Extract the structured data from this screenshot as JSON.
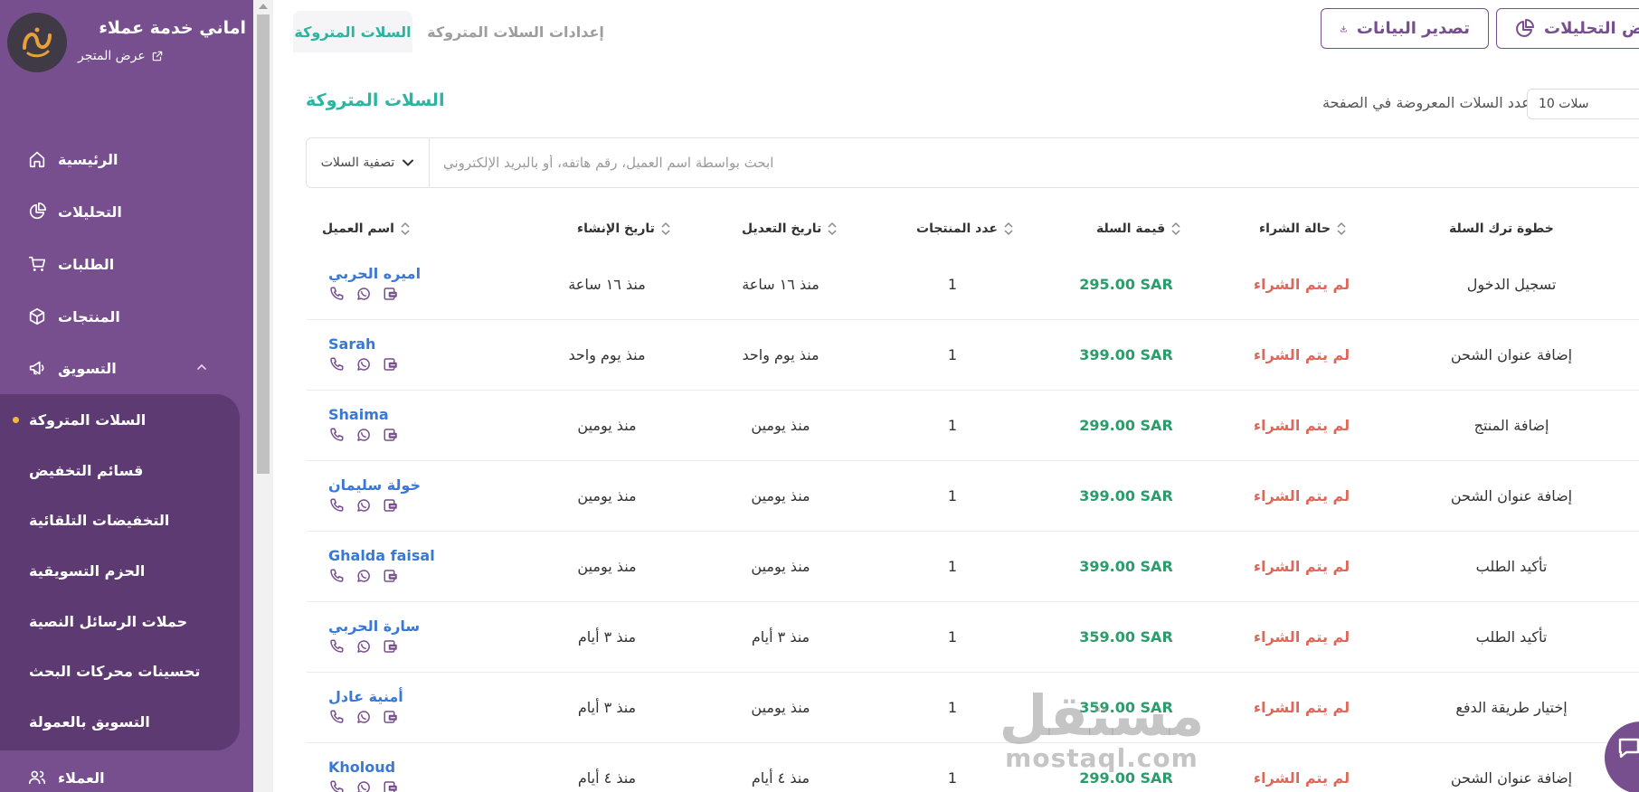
{
  "brand": {
    "name": "اماني خدمة عملاء",
    "store_link": "عرض المتجر"
  },
  "nav": {
    "home": "الرئيسية",
    "analytics": "التحليلات",
    "orders": "الطلبات",
    "products": "المنتجات",
    "marketing": "التسويق",
    "customers": "العملاء"
  },
  "marketing_sub": {
    "abandoned_carts": "السلات المتروكة",
    "coupons": "قسائم التخفيض",
    "auto_discounts": "التخفيضات التلقائية",
    "bundles": "الحزم التسويقية",
    "sms_campaigns": "حملات الرسائل النصية",
    "seo": "تحسينات محركات البحث",
    "affiliate": "التسويق بالعمولة"
  },
  "tabs": {
    "abandoned": "السلات المتروكة",
    "settings": "إعدادات السلات المتروكة"
  },
  "buttons": {
    "export": "تصدير البيانات",
    "analytics": "عرض التحليلات"
  },
  "section_title": "السلات المتروكة",
  "per_page": {
    "label": "عدد السلات المعروضة في الصفحة",
    "value": "10 سلات"
  },
  "search": {
    "placeholder": "ابحث بواسطة اسم العميل، رقم هاتفه، أو بالبريد الإلكتروني",
    "filter": "تصفية السلات"
  },
  "columns": {
    "customer": "اسم العميل",
    "created": "تاريخ الإنشاء",
    "modified": "تاريخ التعديل",
    "products": "عدد المنتجات",
    "value": "قيمة السلة",
    "status": "حالة الشراء",
    "step": "خطوة ترك السلة"
  },
  "rows": [
    {
      "customer": "اميره الحربي",
      "created": "منذ ١٦ ساعة",
      "modified": "منذ ١٦ ساعة",
      "products": "1",
      "value": "295.00 SAR",
      "status": "لم يتم الشراء",
      "step": "تسجيل الدخول"
    },
    {
      "customer": "Sarah",
      "created": "منذ يوم واحد",
      "modified": "منذ يوم واحد",
      "products": "1",
      "value": "399.00 SAR",
      "status": "لم يتم الشراء",
      "step": "إضافة عنوان الشحن"
    },
    {
      "customer": "Shaima",
      "created": "منذ يومين",
      "modified": "منذ يومين",
      "products": "1",
      "value": "299.00 SAR",
      "status": "لم يتم الشراء",
      "step": "إضافة المنتج"
    },
    {
      "customer": "خولة سليمان",
      "created": "منذ يومين",
      "modified": "منذ يومين",
      "products": "1",
      "value": "399.00 SAR",
      "status": "لم يتم الشراء",
      "step": "إضافة عنوان الشحن"
    },
    {
      "customer": "Ghalda faisal",
      "created": "منذ يومين",
      "modified": "منذ يومين",
      "products": "1",
      "value": "399.00 SAR",
      "status": "لم يتم الشراء",
      "step": "تأكيد الطلب"
    },
    {
      "customer": "سارة الحربي",
      "created": "منذ ٣ أيام",
      "modified": "منذ ٣ أيام",
      "products": "1",
      "value": "359.00 SAR",
      "status": "لم يتم الشراء",
      "step": "تأكيد الطلب"
    },
    {
      "customer": "أمنية عادل",
      "created": "منذ ٣ أيام",
      "modified": "منذ يومين",
      "products": "1",
      "value": "359.00 SAR",
      "status": "لم يتم الشراء",
      "step": "إختيار طريقة الدفع"
    },
    {
      "customer": "Kholoud",
      "created": "منذ ٤ أيام",
      "modified": "منذ ٤ أيام",
      "products": "1",
      "value": "299.00 SAR",
      "status": "لم يتم الشراء",
      "step": "إضافة عنوان الشحن"
    }
  ],
  "watermark": {
    "arabic": "مستقل",
    "latin": "mostaql.com"
  },
  "colors": {
    "sidebar": "#774f8e",
    "submenu": "#5d3b72",
    "accent": "#2bb4a0",
    "price": "#2a9d6a",
    "status": "#e0685a",
    "link": "#3a78d6"
  }
}
